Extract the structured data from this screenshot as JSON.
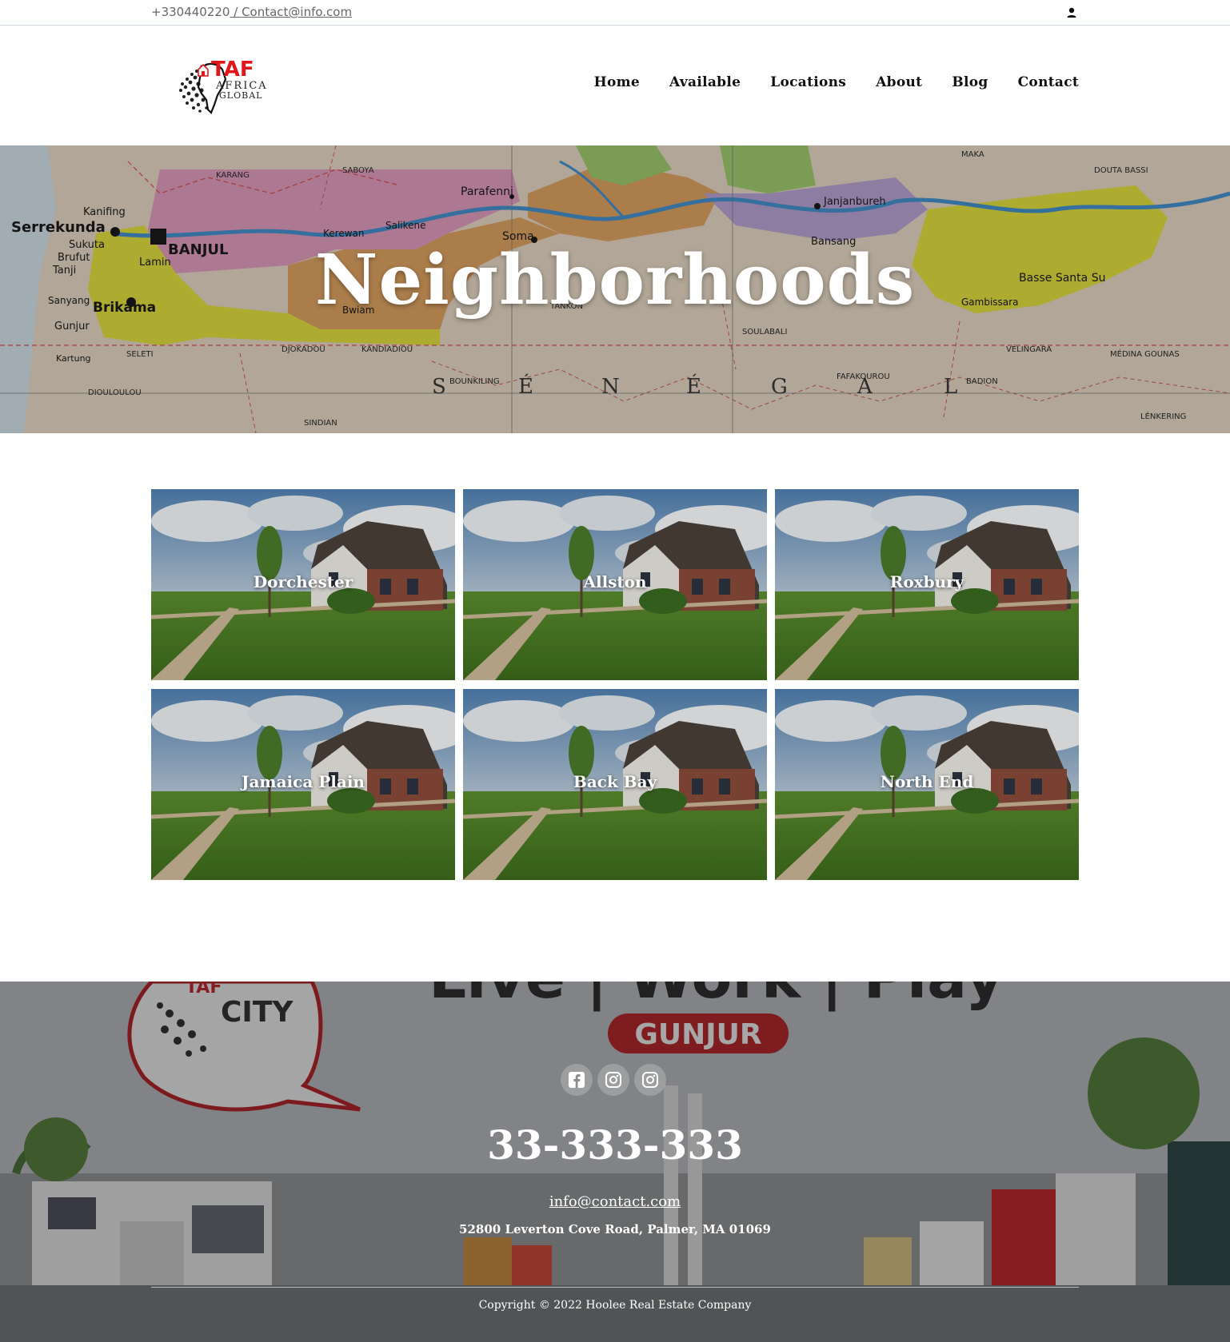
{
  "topbar": {
    "phone": "+330440220",
    "separator": " / ",
    "email": "Contact@info.com",
    "user_icon": "user-icon"
  },
  "header": {
    "logo_text_1": "TAF",
    "logo_text_2": "AFRICA",
    "logo_text_3": "GLOBAL",
    "nav": [
      "Home",
      "Available",
      "Locations",
      "About",
      "Blog",
      "Contact"
    ]
  },
  "hero": {
    "title": "Neighborhoods",
    "map_labels": [
      "Serrekunda",
      "BANJUL",
      "Brikama",
      "Kanifing",
      "Sukuta",
      "Brufut",
      "Tanji",
      "Sanyang",
      "Gunjur",
      "Kartung",
      "Lamin",
      "Soma",
      "Parafenni",
      "Basse Santa Su",
      "Janjanbureh",
      "Bansang",
      "Kerewan",
      "Salikene",
      "Bwiam",
      "Gambissara",
      "S",
      "É",
      "N",
      "É",
      "G",
      "A",
      "L",
      "TANKON",
      "SOULABALI",
      "DIOULOULOU",
      "SINDIAN",
      "BOUNKILING",
      "MAKA",
      "DOUTA BASSI",
      "VÉLINGARA",
      "BADION",
      "FAFAKOUROU",
      "LÉNKERING",
      "MÉDINA GOUNAS",
      "KARANG",
      "SABOYA",
      "DJOKADOU",
      "KANDIADIOU",
      "SELETI"
    ]
  },
  "neighborhoods": [
    {
      "name": "Dorchester"
    },
    {
      "name": "Allston"
    },
    {
      "name": "Roxbury"
    },
    {
      "name": "Jamaica Plain"
    },
    {
      "name": "Back Bay"
    },
    {
      "name": "North End"
    }
  ],
  "footer": {
    "bg_text": {
      "slogan": "Live | Work | Play",
      "place": "GUNJUR",
      "brand": "CITY",
      "brand_prefix": "TAF"
    },
    "social": [
      {
        "name": "facebook-icon"
      },
      {
        "name": "instagram-icon"
      },
      {
        "name": "instagram-icon"
      }
    ],
    "phone": "33-333-333",
    "email": "info@contact.com",
    "address": "52800 Leverton Cove Road, Palmer, MA 01069",
    "copyright": "Copyright © 2022 Hoolee Real Estate Company"
  },
  "colors": {
    "accent_red": "#e0161b",
    "map_pink": "#e59bc0",
    "map_yellow": "#e6e23a",
    "map_orange": "#e2a35e",
    "map_green": "#9fce6a",
    "map_purple": "#b9a3d6",
    "river": "#3e8fd0"
  }
}
